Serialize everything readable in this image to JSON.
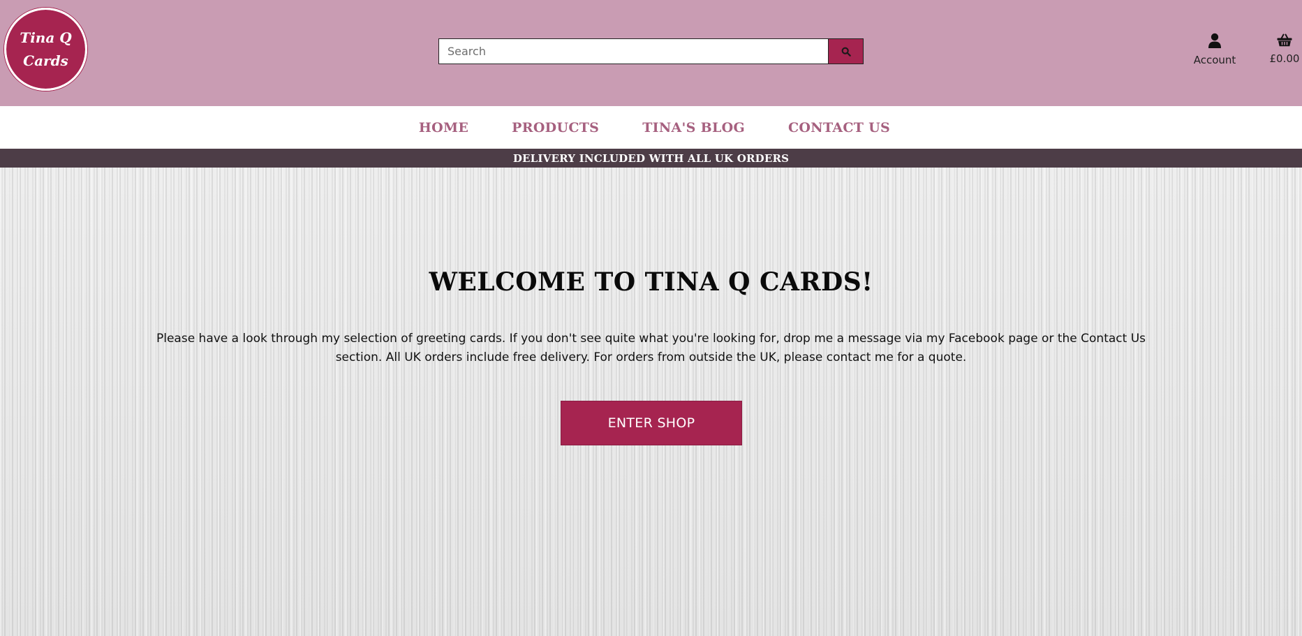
{
  "header": {
    "logo": {
      "line1": "Tina Q",
      "line2": "Cards"
    },
    "search": {
      "placeholder": "Search",
      "value": "",
      "button_icon": "search-icon"
    },
    "account": {
      "label": "Account",
      "icon": "user-icon"
    },
    "basket": {
      "total": "£0.00",
      "icon": "shopping-basket-icon"
    }
  },
  "nav": {
    "items": [
      {
        "label": "HOME"
      },
      {
        "label": "PRODUCTS"
      },
      {
        "label": "TINA'S BLOG"
      },
      {
        "label": "CONTACT US"
      }
    ]
  },
  "banner": {
    "text": "DELIVERY INCLUDED WITH ALL UK ORDERS"
  },
  "hero": {
    "title": "WELCOME TO TINA Q CARDS!",
    "body": "Please have a look through my selection of greeting cards. If you don't see quite what you're looking for, drop me a message via my Facebook page or the Contact Us section. All UK orders include free delivery. For orders from outside the UK, please contact me for a quote.",
    "button_label": "ENTER SHOP"
  },
  "colors": {
    "header_bg": "#c99cb3",
    "brand": "#a62450",
    "nav_text": "#a6607f",
    "banner_bg": "#4d3d47"
  }
}
